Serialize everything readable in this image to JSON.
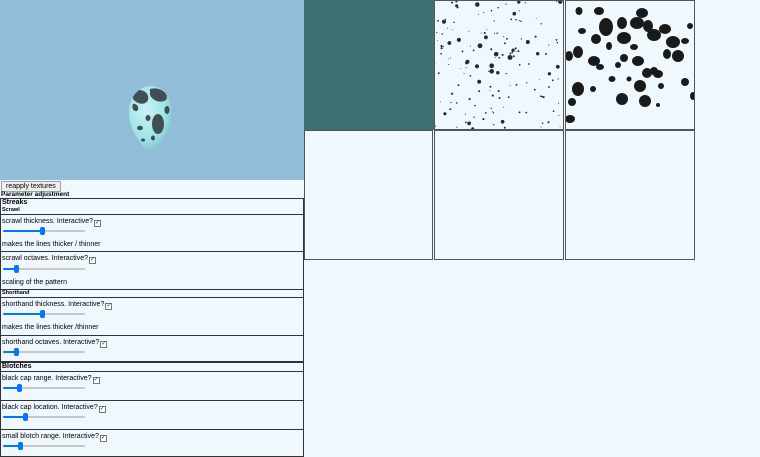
{
  "panel": {
    "reapply_label": "reapply textures",
    "title": "Parameter adjustment"
  },
  "streaks": {
    "title": "Streaks",
    "scrawl": {
      "title": "Scrawl",
      "thickness": {
        "label": "scrawl thickness. Interactive?",
        "checked": true,
        "value": 0.48,
        "description": "makes the lines thicker / thinner"
      },
      "octaves": {
        "label": "scrawl octaves. Interactive?",
        "checked": true,
        "value": 0.14,
        "description": "scaling of the pattern"
      }
    },
    "shorthand": {
      "title": "Shorthand",
      "thickness": {
        "label": "shorthand thickness. Interactive?",
        "checked": true,
        "value": 0.48,
        "description": "makes the lines thicker /thinner"
      },
      "octaves": {
        "label": "shorthand octaves. Interactive?",
        "checked": true,
        "value": 0.14
      }
    }
  },
  "blotches": {
    "title": "Blotches",
    "black_cap_range": {
      "label": "black cap range. Interactive?",
      "checked": true,
      "value": 0.18
    },
    "black_cap_location": {
      "label": "black cap location. Interactive?",
      "checked": true,
      "value": 0.26
    },
    "small_blotch_range": {
      "label": "small blotch range. Interactive?",
      "checked": true,
      "value": 0.2
    }
  },
  "colors": {
    "viewport_bg": "#91bdd8",
    "egg_base": "#9fe3e6",
    "egg_spots": "#3f4f53",
    "tile_teal": "#3c7073",
    "spot_black": "#1a1a1a",
    "accent": "#0075ff"
  },
  "icons": {
    "checkbox": "checkbox-checked-icon",
    "slider": "range-slider-icon"
  }
}
